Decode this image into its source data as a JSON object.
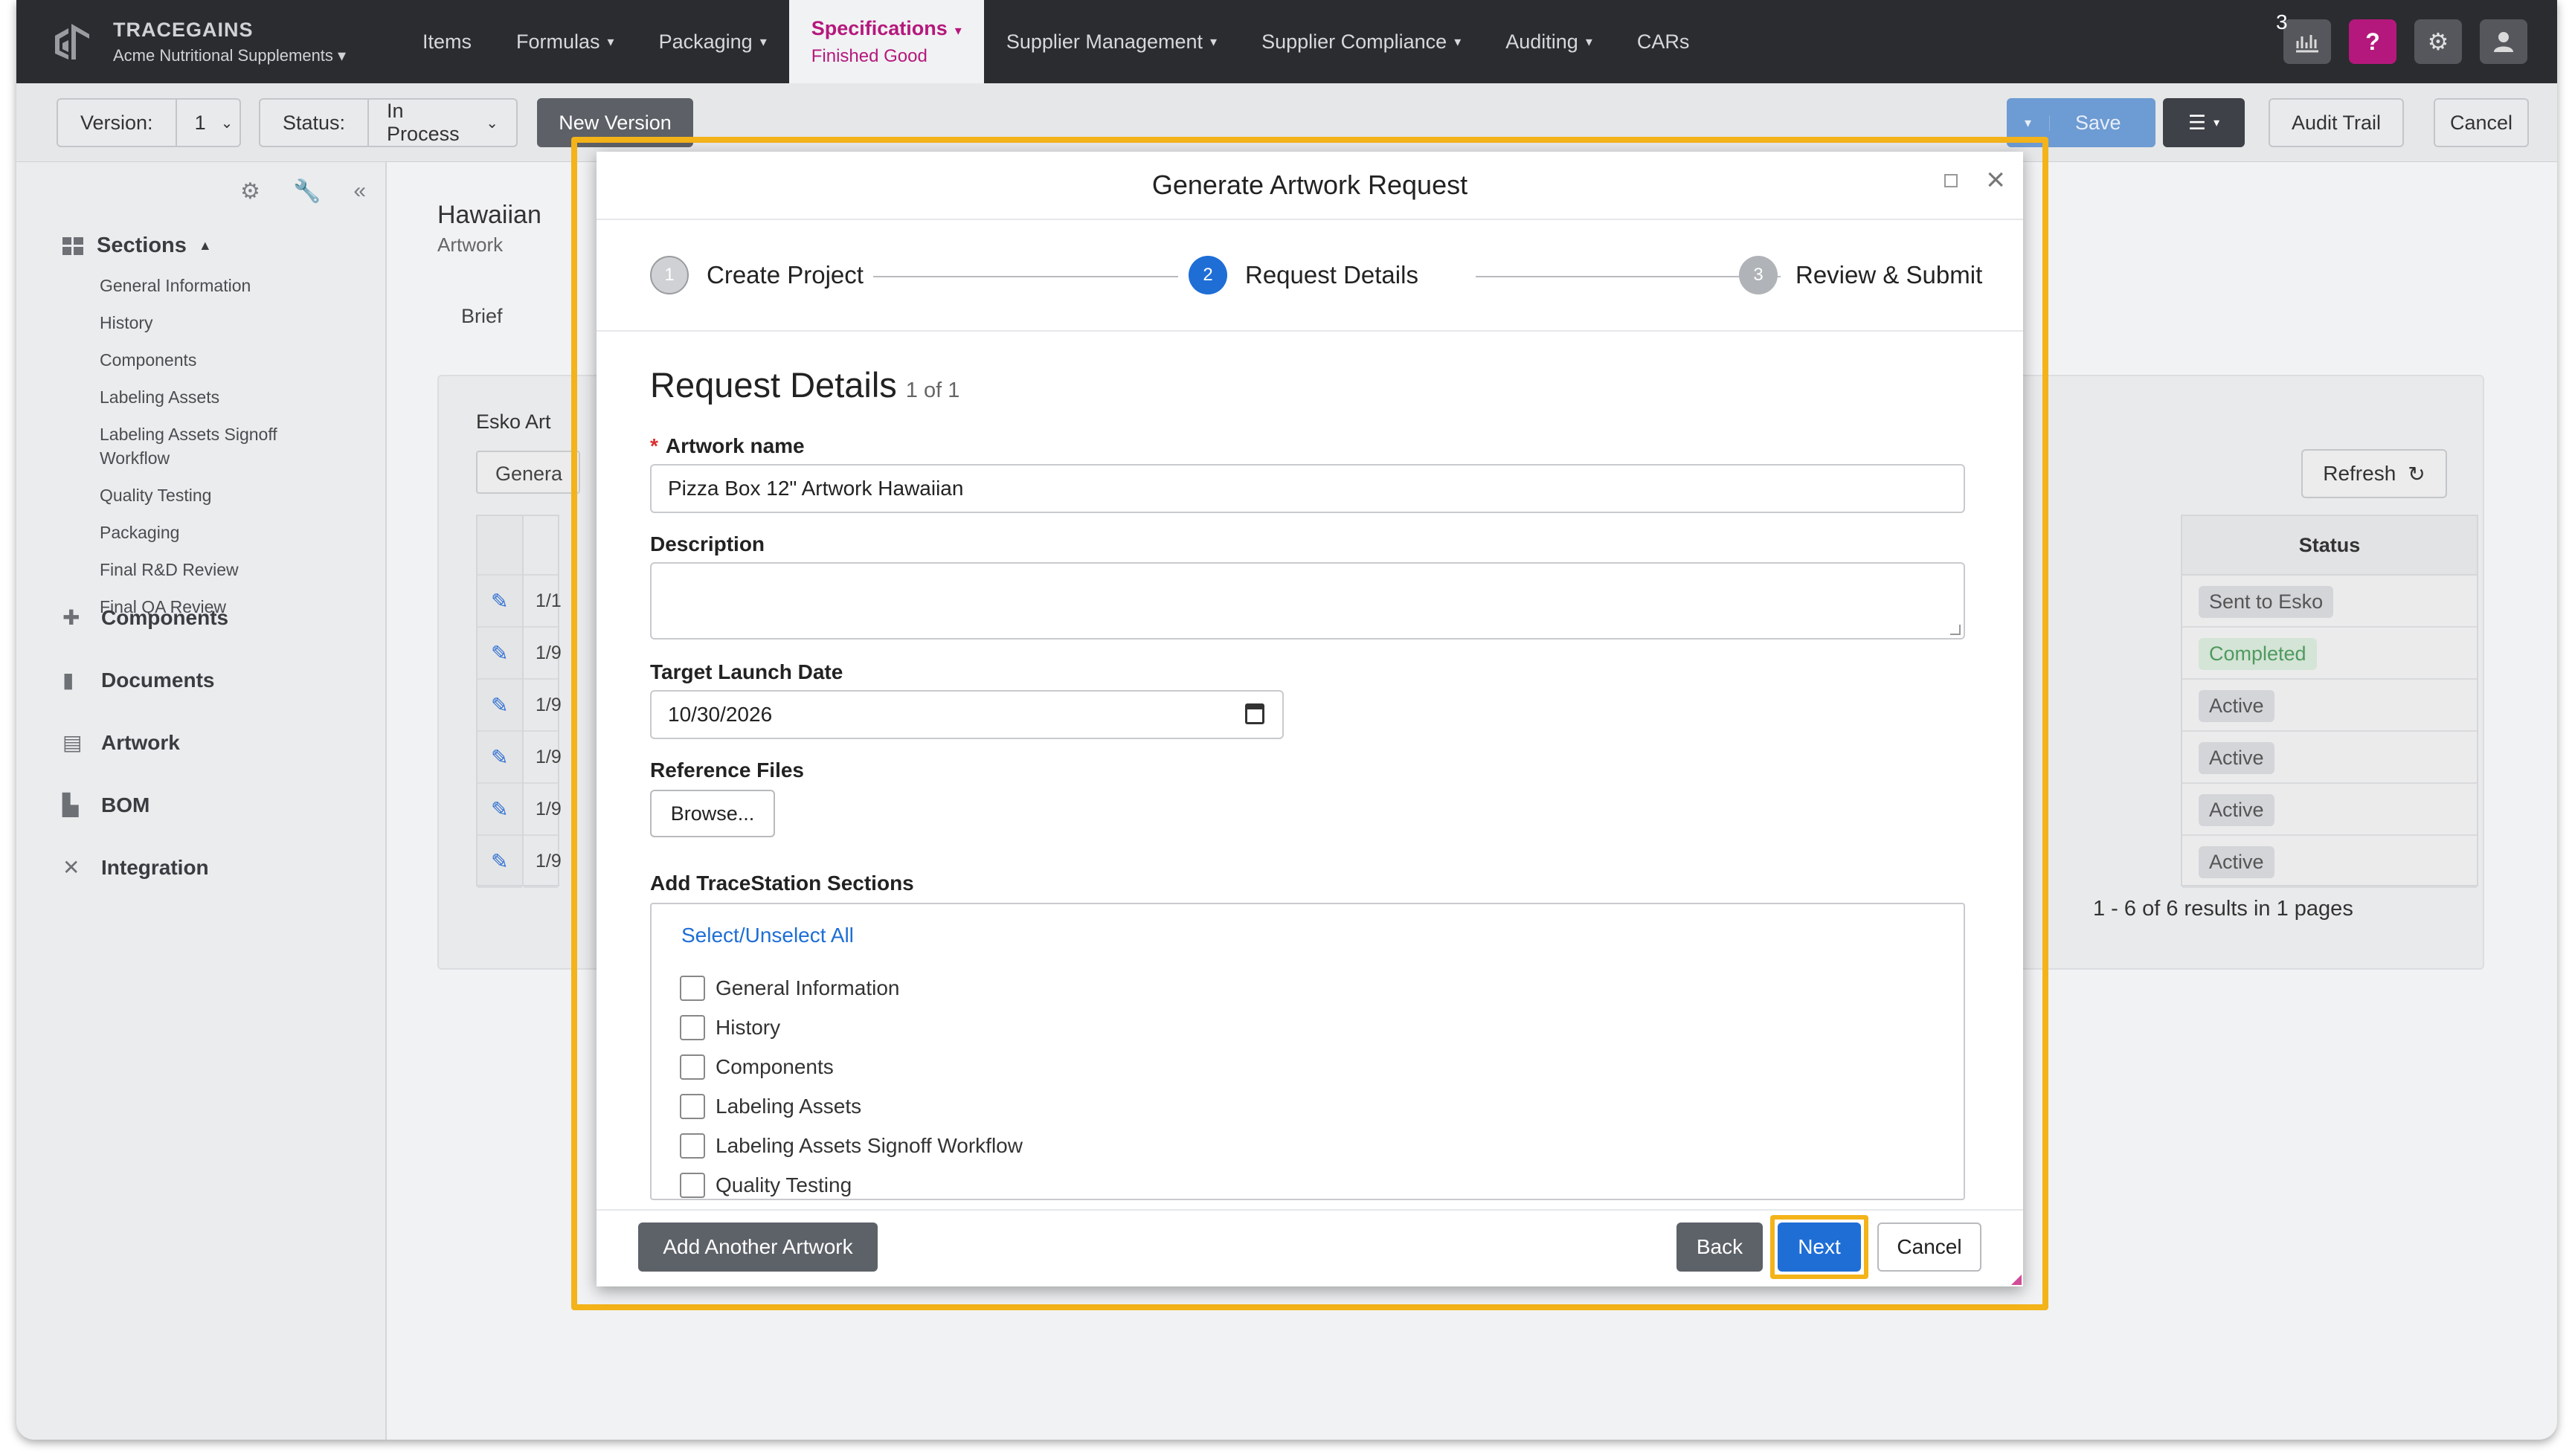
{
  "brand": {
    "name": "TRACEGAINS",
    "company": "Acme Nutritional Supplements"
  },
  "nav": {
    "items": [
      {
        "label": "Items",
        "has_caret": false
      },
      {
        "label": "Formulas",
        "has_caret": true
      },
      {
        "label": "Packaging",
        "has_caret": true
      },
      {
        "label": "Specifications",
        "sub": "Finished Good",
        "has_caret": true,
        "active": true
      },
      {
        "label": "Supplier Management",
        "has_caret": true
      },
      {
        "label": "Supplier Compliance",
        "has_caret": true
      },
      {
        "label": "Auditing",
        "has_caret": true
      },
      {
        "label": "CARs",
        "has_caret": false
      }
    ],
    "notification_count": "3",
    "help_label": "?",
    "icons": [
      "analytics-icon",
      "help-icon",
      "gear-icon",
      "user-icon"
    ]
  },
  "toolbar": {
    "version_label": "Version:",
    "version_value": "1",
    "status_label": "Status:",
    "status_value": "In Process",
    "new_version": "New Version",
    "save": "Save",
    "audit_trail": "Audit Trail",
    "cancel": "Cancel"
  },
  "sidebar": {
    "sections_label": "Sections",
    "sub_items": [
      "General Information",
      "History",
      "Components",
      "Labeling Assets",
      "Labeling Assets Signoff Workflow",
      "Quality Testing",
      "Packaging",
      "Final R&D Review",
      "Final QA Review"
    ],
    "main_items": [
      {
        "label": "Components",
        "icon": "puzzle-icon"
      },
      {
        "label": "Documents",
        "icon": "document-icon"
      },
      {
        "label": "Artwork",
        "icon": "artwork-icon"
      },
      {
        "label": "BOM",
        "icon": "bom-icon"
      },
      {
        "label": "Integration",
        "icon": "tools-icon"
      }
    ]
  },
  "content": {
    "title": "Hawaiian",
    "subtitle": "Artwork",
    "tab": "Brief",
    "panel_label": "Esko Art",
    "generate_stub": "Genera",
    "refresh": "Refresh",
    "status_header": "Status",
    "row_dates": [
      "1/1",
      "1/9",
      "1/9",
      "1/9",
      "1/9",
      "1/9"
    ],
    "statuses": [
      "Sent to Esko",
      "Completed",
      "Active",
      "Active",
      "Active",
      "Active"
    ],
    "pager": "1 - 6 of 6 results in 1 pages"
  },
  "modal": {
    "title": "Generate Artwork Request",
    "steps": [
      {
        "num": "1",
        "label": "Create Project",
        "state": "done"
      },
      {
        "num": "2",
        "label": "Request Details",
        "state": "current"
      },
      {
        "num": "3",
        "label": "Review & Submit",
        "state": "todo"
      }
    ],
    "heading": "Request Details",
    "heading_count": "1 of 1",
    "artwork_name_label": "Artwork name",
    "artwork_name_value": "Pizza Box 12\" Artwork Hawaiian",
    "description_label": "Description",
    "description_value": "",
    "target_date_label": "Target Launch Date",
    "target_date_value": "10/30/2026",
    "reference_files_label": "Reference Files",
    "browse": "Browse...",
    "sections_label": "Add TraceStation Sections",
    "select_all": "Select/Unselect All",
    "section_options": [
      "General Information",
      "History",
      "Components",
      "Labeling Assets",
      "Labeling Assets Signoff Workflow",
      "Quality Testing"
    ],
    "add_another": "Add Another Artwork",
    "back": "Back",
    "next": "Next",
    "cancel": "Cancel"
  }
}
